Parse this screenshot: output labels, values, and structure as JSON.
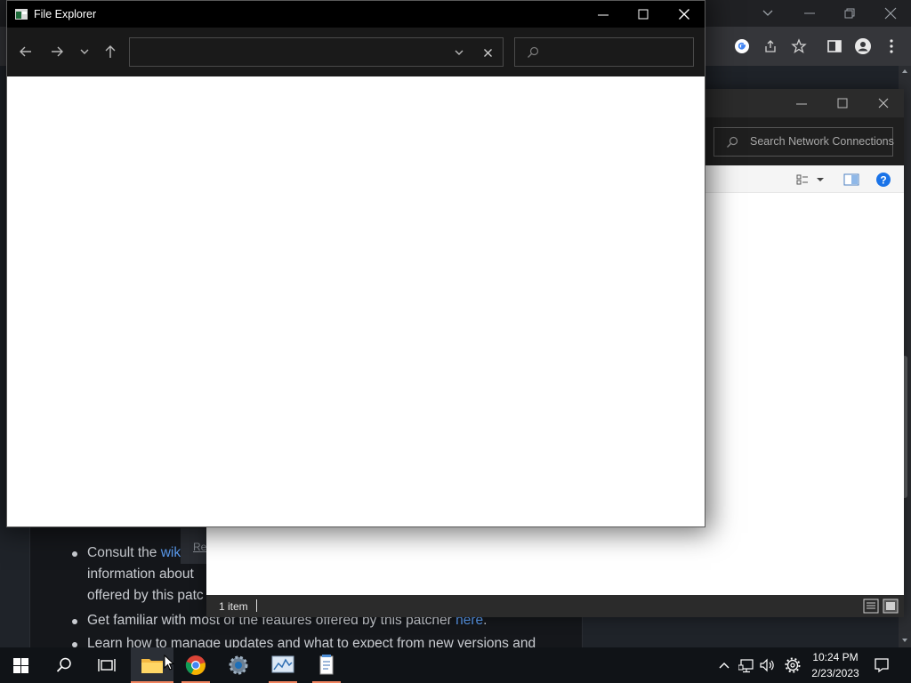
{
  "file_explorer": {
    "title": "File Explorer",
    "address": {
      "value": "",
      "placeholder": ""
    },
    "search": {
      "placeholder": ""
    },
    "icons": {
      "window_icon": "file-explorer-icon",
      "back": "arrow-left-icon",
      "forward": "arrow-right-icon",
      "recent": "chevron-down-icon",
      "up": "arrow-up-icon",
      "address_dropdown": "chevron-down-icon",
      "address_clear": "close-icon",
      "search": "search-icon",
      "minimize": "minimize-icon",
      "maximize": "maximize-icon",
      "close": "close-icon"
    }
  },
  "network_connections": {
    "search_placeholder": "Search Network Connections",
    "status_items": "1 item",
    "icons": {
      "search": "search-icon",
      "view_options": "view-options-icon",
      "preview_pane": "preview-pane-icon",
      "help": "help-icon",
      "details_view": "details-view-icon",
      "large_icons_view": "large-icons-view-icon"
    }
  },
  "browser_page": {
    "bullets": [
      {
        "before": "Consult the ",
        "link": "wik",
        "after": ""
      },
      {
        "before": "information about",
        "link": "",
        "after": ""
      },
      {
        "before": "offered by this patc",
        "link": "",
        "after": ""
      },
      {
        "before": "Get familiar with most of the features offered by this patcher ",
        "link": "here",
        "after": "."
      },
      {
        "before": "Learn how to manage updates and what to expect from new versions and",
        "link": "",
        "after": ""
      }
    ],
    "partial_link": "Re"
  },
  "taskbar": {
    "time": "10:24 PM",
    "date": "2/23/2023",
    "apps": [
      "windows-start-icon",
      "search-icon",
      "task-view-icon",
      "file-explorer-icon",
      "chrome-icon",
      "settings-icon",
      "resource-monitor-icon",
      "notepad-icon"
    ]
  },
  "colors": {
    "accent_active": "#f0845f",
    "help_blue": "#1a73e8",
    "link_blue": "#5b9cf0"
  }
}
